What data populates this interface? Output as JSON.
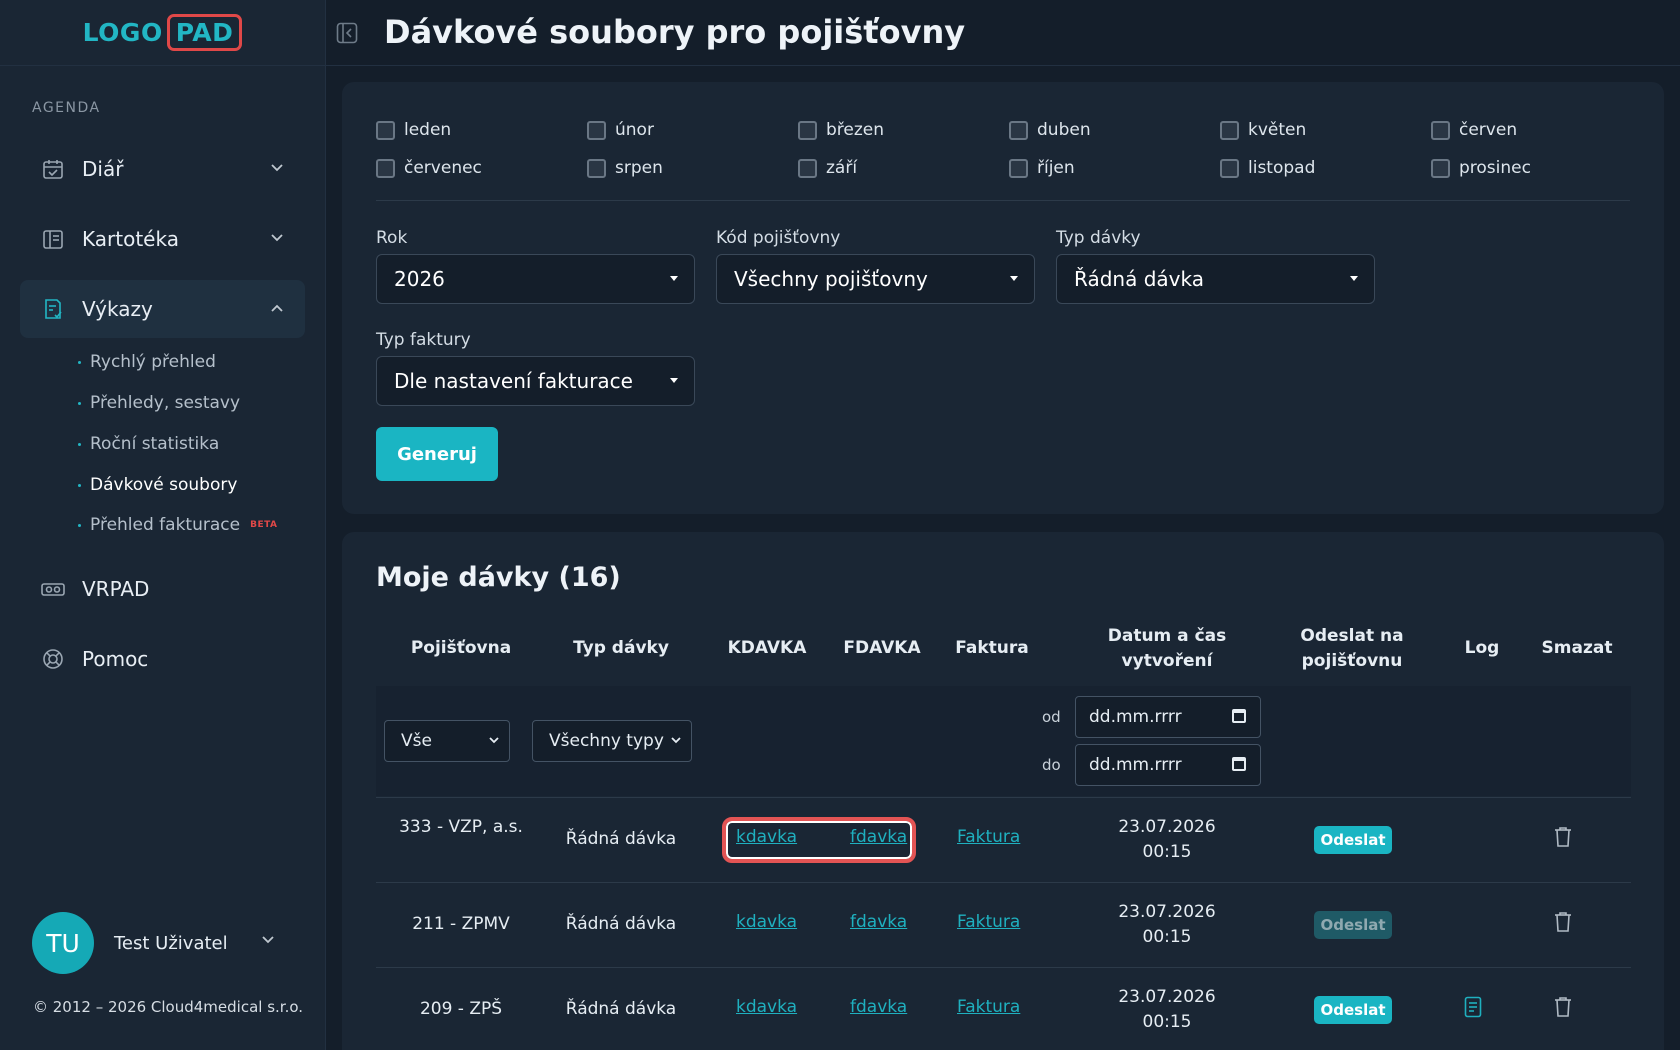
{
  "logo": {
    "part1": "LOGO",
    "part2": "PAD"
  },
  "sidebar": {
    "section_label": "AGENDA",
    "items": [
      {
        "label": "Diář",
        "icon": "calendar-icon"
      },
      {
        "label": "Kartotéka",
        "icon": "book-icon"
      },
      {
        "label": "Výkazy",
        "icon": "report-icon"
      },
      {
        "label": "VRPAD",
        "icon": "vr-headset-icon"
      },
      {
        "label": "Pomoc",
        "icon": "lifebuoy-icon"
      }
    ],
    "sub_items": [
      {
        "label": "Rychlý přehled"
      },
      {
        "label": "Přehledy, sestavy"
      },
      {
        "label": "Roční statistika"
      },
      {
        "label": "Dávkové soubory"
      },
      {
        "label": "Přehled fakturace",
        "badge": "BETA"
      }
    ],
    "user": {
      "initials": "TU",
      "name": "Test Uživatel"
    },
    "copyright": "© 2012 – 2026 Cloud4medical s.r.o."
  },
  "header": {
    "title": "Dávkové soubory pro pojišťovny"
  },
  "filters": {
    "months": [
      "leden",
      "únor",
      "březen",
      "duben",
      "květen",
      "červen",
      "červenec",
      "srpen",
      "září",
      "říjen",
      "listopad",
      "prosinec"
    ],
    "rok_label": "Rok",
    "rok_value": "2026",
    "kod_label": "Kód pojišťovny",
    "kod_value": "Všechny pojišťovny",
    "typ_label": "Typ dávky",
    "typ_value": "Řádná dávka",
    "faktura_label": "Typ faktury",
    "faktura_value": "Dle nastavení fakturace",
    "generate_label": "Generuj"
  },
  "batches": {
    "title": "Moje dávky (16)",
    "columns": [
      "Pojišťovna",
      "Typ dávky",
      "KDAVKA",
      "FDAVKA",
      "Faktura",
      "Datum a čas vytvoření",
      "Odeslat na pojišťovnu",
      "Log",
      "Smazat"
    ],
    "filter_pojistovna": "Vše",
    "filter_typ": "Všechny typy",
    "date_from_label": "od",
    "date_to_label": "do",
    "date_placeholder": "dd.mm.rrrr",
    "rows": [
      {
        "pojistovna": "333 - VZP, a.s.",
        "typ": "Řádná dávka",
        "kdavka": "kdavka",
        "fdavka": "fdavka",
        "faktura": "Faktura",
        "date": "23.07.2026",
        "time": "00:15",
        "send": "Odeslat",
        "send_enabled": true,
        "log": false
      },
      {
        "pojistovna": "211 - ZPMV",
        "typ": "Řádná dávka",
        "kdavka": "kdavka",
        "fdavka": "fdavka",
        "faktura": "Faktura",
        "date": "23.07.2026",
        "time": "00:15",
        "send": "Odeslat",
        "send_enabled": false,
        "log": false
      },
      {
        "pojistovna": "209 - ZPŠ",
        "typ": "Řádná dávka",
        "kdavka": "kdavka",
        "fdavka": "fdavka",
        "faktura": "Faktura",
        "date": "23.07.2026",
        "time": "00:15",
        "send": "Odeslat",
        "send_enabled": true,
        "log": true
      }
    ]
  },
  "colors": {
    "accent": "#1ab5c3",
    "highlight": "#e35454",
    "background": "#141e2a",
    "panel": "#1a2634"
  }
}
